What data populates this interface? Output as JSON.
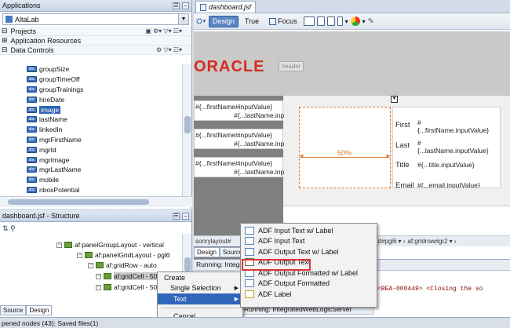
{
  "applications": {
    "title": "Applications",
    "app_name": "AltaLab",
    "projects_label": "Projects",
    "app_resources_label": "Application Resources",
    "data_controls_label": "Data Controls",
    "items": [
      "groupSize",
      "groupTimeOff",
      "groupTrainings",
      "hireDate",
      "image",
      "lastName",
      "linkedIn",
      "mgrFirstName",
      "mgrId",
      "mgrImage",
      "mgrLastName",
      "mobile",
      "nboxPotential"
    ],
    "selected_index": 4
  },
  "structure": {
    "title": "dashboard.jsf - Structure",
    "rows": [
      {
        "label": "af:panelGroupLayout - vertical",
        "indent": 0
      },
      {
        "label": "af:panelGridLayout - pgl6",
        "indent": 1
      },
      {
        "label": "af:gridRow - auto",
        "indent": 2
      },
      {
        "label": "af:gridCell - 50%",
        "indent": 3
      },
      {
        "label": "af:gridCell - 50%",
        "indent": 3
      }
    ],
    "tabs": [
      "Source",
      "Design"
    ]
  },
  "editor": {
    "tab_label": "dashboard.jsf",
    "toolbar": {
      "design": "Design",
      "true": "True",
      "focus": "Focus"
    },
    "oracle_logo": "ORACLE",
    "header_badge": "header",
    "left_fields": [
      {
        "line1": "#{...firstName#inputValue}",
        "line2": "#{...lastName.inp"
      },
      {
        "line1": "#{...firstName#inputValue}",
        "line2": "#{...lastName.inp"
      },
      {
        "line1": "#{...firstName#inputValue}",
        "line2": "#{...lastName.inp"
      }
    ],
    "percent_label": "50%",
    "form": [
      {
        "label": "First",
        "value1": "#",
        "value2": "{...firstName.inputValue}"
      },
      {
        "label": "Last",
        "value1": "#",
        "value2": "{...lastName.inputValue}"
      },
      {
        "label": "Title",
        "value1": "#{...title.inputValue}",
        "value2": ""
      },
      {
        "label": "Email",
        "value1": "#{...email.inputValue}",
        "value2": ""
      }
    ],
    "breadcrumbs": [
      "sonrylayout#",
      "af:gridlayout#pgl6",
      "af:gridrow#gr2"
    ],
    "bottom_tabs": [
      "Design",
      "Source"
    ],
    "running_label": "Running: Integrat",
    "running_label2": "Running: IntegratedWebLogicServer",
    "log_text": "ket> <BEA-000449> <Closing the so"
  },
  "context_menu": {
    "items": [
      "Create",
      "Single Selection",
      "Text",
      "Cancel"
    ],
    "highlighted": "Text"
  },
  "text_submenu": {
    "items": [
      "ADF Input Text w/ Label",
      "ADF Input Text",
      "ADF Output Text w/ Label",
      "ADF Output Text",
      "ADF Output Formatted w/ Label",
      "ADF Output Formatted",
      "ADF Label"
    ],
    "boxed_index": 3
  },
  "status": {
    "text": "pened nodes (43); Saved files(1)",
    "bottom_left_tabs": [
      "Source",
      "Design"
    ]
  },
  "colors": {
    "accent": "#2f66b9",
    "oracle_red": "#d52b1e",
    "highlight_box": "#e53030"
  }
}
